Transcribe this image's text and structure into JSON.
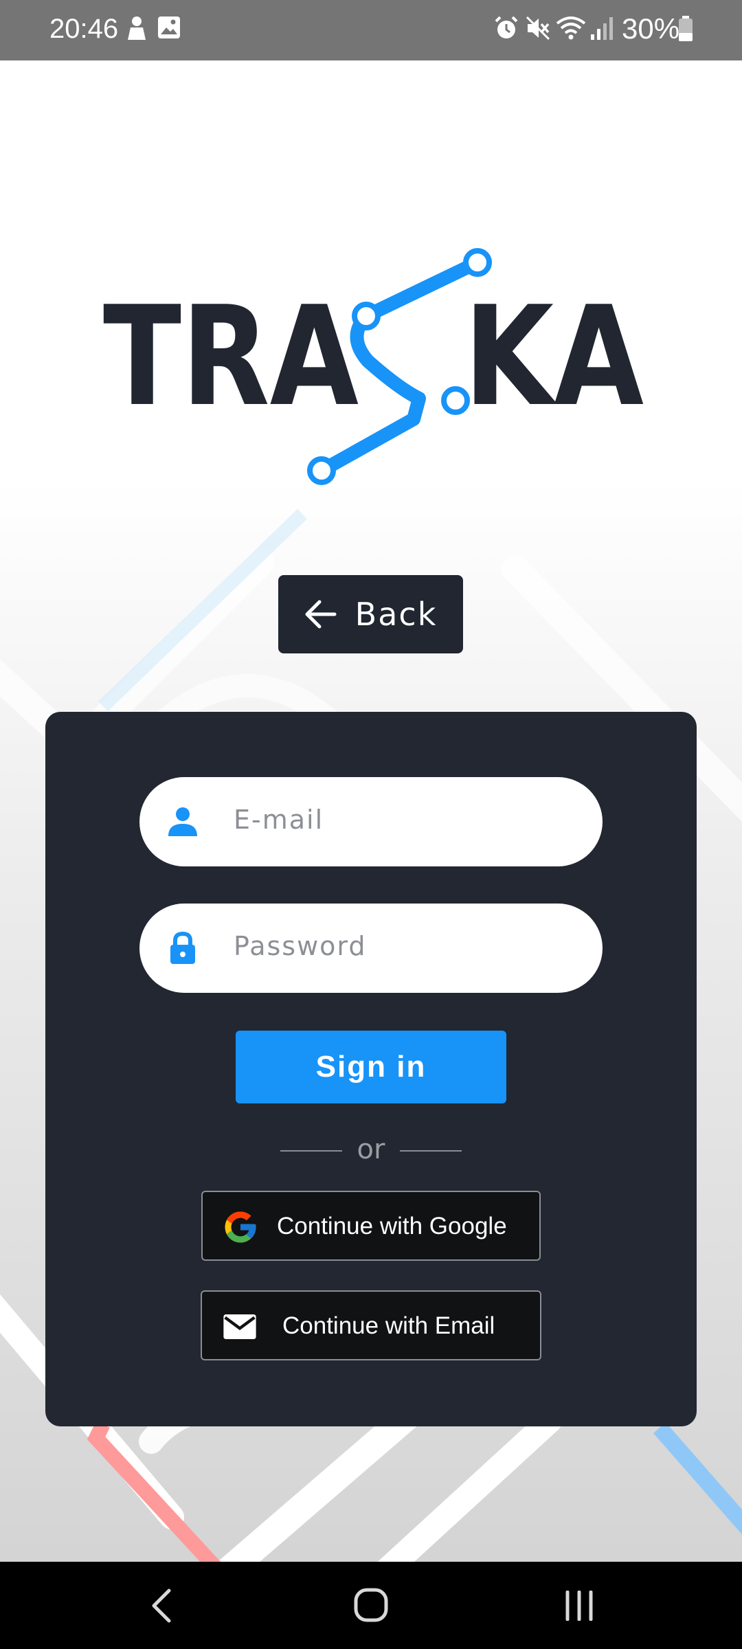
{
  "status_bar": {
    "time": "20:46",
    "battery": "30%",
    "icons": [
      "person-icon",
      "gallery-icon",
      "alarm-icon",
      "mute-icon",
      "wifi-icon",
      "signal-icon",
      "battery-icon"
    ]
  },
  "brand": {
    "logo_text": "TRASKA",
    "logo_text_color": "#212630",
    "route_color": "#1893f8"
  },
  "back_button": {
    "label": "Back",
    "icon": "arrow-left-icon"
  },
  "login_form": {
    "email_placeholder": "E-mail",
    "email_icon": "person-icon",
    "password_placeholder": "Password",
    "password_icon": "lock-icon",
    "sign_in_label": "Sign in",
    "divider_text": "or",
    "google_label": "Continue with Google",
    "google_icon": "google-g-icon",
    "email_label": "Continue with Email",
    "email_btn_icon": "mail-icon"
  },
  "colors": {
    "accent": "#1893f8",
    "card": "#222731",
    "status_bar": "#757575"
  },
  "nav_bar": {
    "icons": [
      "back-nav-icon",
      "home-nav-icon",
      "recents-nav-icon"
    ]
  }
}
